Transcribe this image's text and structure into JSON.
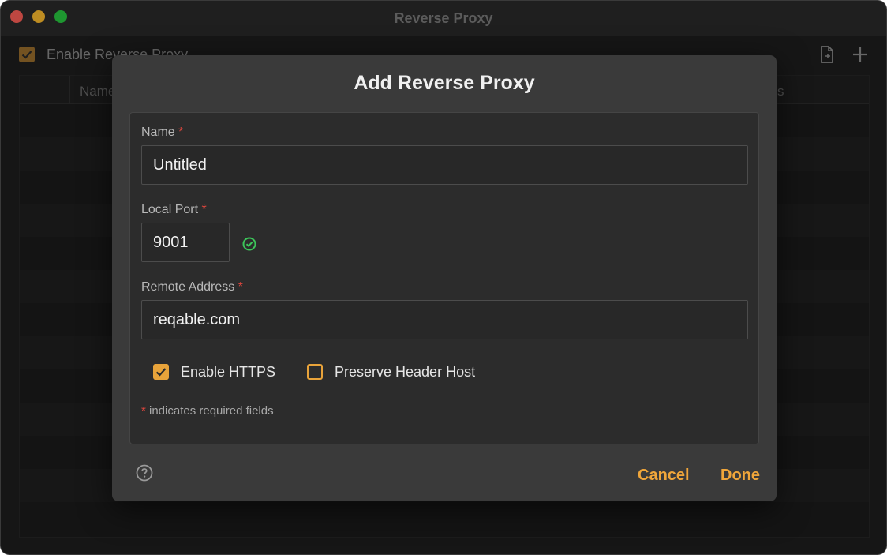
{
  "window": {
    "title": "Reverse Proxy"
  },
  "background": {
    "enable_label": "Enable Reverse Proxy",
    "enabled": true,
    "table": {
      "columns": [
        "Name",
        "s"
      ]
    }
  },
  "toolbar": {
    "icons": [
      "import-file-icon",
      "plus-icon"
    ]
  },
  "dialog": {
    "title": "Add Reverse Proxy",
    "name": {
      "label": "Name",
      "required_mark": "*",
      "value": "Untitled"
    },
    "local_port": {
      "label": "Local Port",
      "required_mark": "*",
      "value": "9001",
      "status": "valid"
    },
    "remote_address": {
      "label": "Remote Address",
      "required_mark": "*",
      "value": "reqable.com"
    },
    "options": {
      "enable_https": {
        "label": "Enable HTTPS",
        "checked": true
      },
      "preserve_header_host": {
        "label": "Preserve Header Host",
        "checked": false
      }
    },
    "hint": {
      "mark": "*",
      "text": " indicates required fields"
    },
    "buttons": {
      "cancel": "Cancel",
      "done": "Done"
    }
  },
  "colors": {
    "accent": "#f0a63a",
    "required": "#e2473e",
    "ok": "#3cc65a"
  }
}
